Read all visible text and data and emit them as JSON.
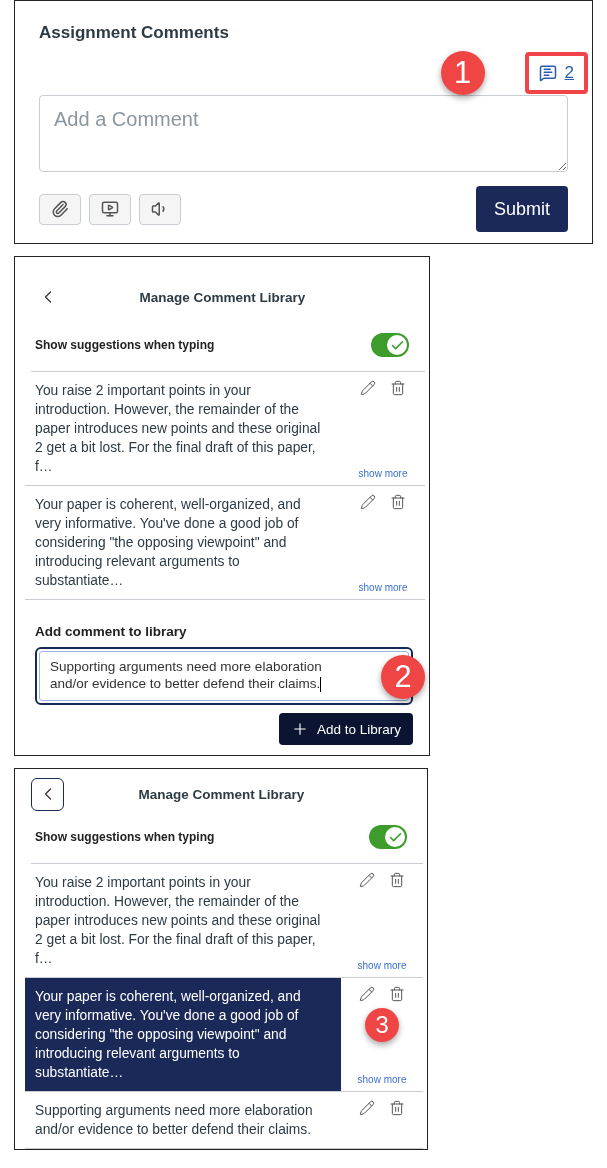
{
  "comment_panel": {
    "title": "Assignment Comments",
    "callout": "1",
    "count": "2",
    "placeholder": "Add a Comment",
    "tools": [
      {
        "kind": "attach"
      },
      {
        "kind": "media"
      },
      {
        "kind": "audio"
      }
    ],
    "submit": "Submit"
  },
  "library_panels": [
    {
      "back_focused": false,
      "title": "Manage Comment Library",
      "suggestion_label": "Show suggestions when typing",
      "suggestions_on": true,
      "comments": [
        {
          "text": "You raise 2 important points in your introduction. However, the remainder of the paper introduces new points and these original 2 get a bit lost. For the final draft of this paper, f…",
          "show_more": "show more",
          "selected": false
        },
        {
          "text": "Your paper is coherent, well-organized, and very informative. You've done a good job of considering \"the opposing viewpoint\" and introducing relevant arguments to substantiate…",
          "show_more": "show more",
          "selected": false
        }
      ],
      "add_form": {
        "label": "Add comment to library",
        "value": "Supporting arguments need more elaboration and/or evidence to better defend their claims.",
        "callout": "2",
        "button": "Add to Library"
      }
    },
    {
      "back_focused": true,
      "title": "Manage Comment Library",
      "suggestion_label": "Show suggestions when typing",
      "suggestions_on": true,
      "comments": [
        {
          "text": "You raise 2 important points in your introduction. However, the remainder of the paper introduces new points and these original 2 get a bit lost. For the final draft of this paper, f…",
          "show_more": "show more",
          "selected": false
        },
        {
          "text": "Your paper is coherent, well-organized, and very informative. You've done a good job of considering \"the opposing viewpoint\" and introducing relevant arguments to substantiate…",
          "show_more": "show more",
          "selected": true,
          "callout": "3"
        },
        {
          "text": "Supporting arguments need more elaboration and/or evidence to better defend their claims.",
          "selected": false
        }
      ]
    }
  ]
}
